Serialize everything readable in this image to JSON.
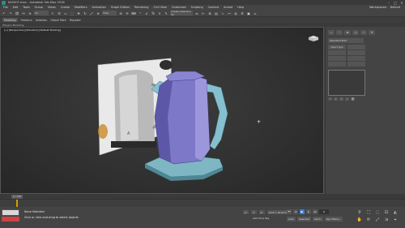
{
  "titlebar": {
    "title": "KA0307.max - Autodesk 3ds Max 2018",
    "minimize": "–",
    "maximize": "□",
    "close": "✕"
  },
  "menubar": {
    "items": [
      "File",
      "Edit",
      "Tools",
      "Group",
      "Views",
      "Create",
      "Modifiers",
      "Animation",
      "Graph Editors",
      "Rendering",
      "Civil View",
      "Customize",
      "Scripting",
      "Content",
      "Arnold",
      "Help"
    ],
    "workspaces": "Workspaces:",
    "workspace_value": "Default"
  },
  "toolbar": {
    "filter_dropdown": "All",
    "view_dropdown": "View",
    "selection_set": "Create Selection Se"
  },
  "ribbon": {
    "modeling_tab": "Modeling",
    "freeform": "Freeform",
    "selection": "Selection",
    "object_paint": "Object Paint",
    "populate": "Populate",
    "sub": "Polygon Modeling"
  },
  "viewport": {
    "label": "[+] [Perspective] [Standard] [Default Shading]"
  },
  "cmdpanel": {
    "tabs": [
      "+",
      "◠",
      "▬",
      "◎",
      "▭",
      "⚒"
    ],
    "dropdown": "Standard Prim",
    "buttons": [
      "Object Type",
      "",
      "",
      "",
      "",
      "",
      "",
      ""
    ],
    "list_icons": [
      "⊣",
      "⟂",
      "⎔",
      "∕",
      "🗑"
    ]
  },
  "timeline": {
    "frame_label": "0 / 100"
  },
  "status": {
    "line1": "None Selected",
    "line2": "Click or click-and-drag to select objects",
    "x": "X:",
    "y": "Y:",
    "z": "Z:",
    "grid": "Grid = 10.0cm",
    "add_time_tag": "Add Time Tag",
    "frame": "0",
    "auto": "Auto",
    "selected": "Selected",
    "set_key": "Set K.",
    "key_filters": "Key Filters..."
  },
  "colors": {
    "kettle_body": "#7e78c8",
    "kettle_base": "#7fb6c4",
    "kettle_handle": "#86bfd0",
    "play_button": "#3a7bd5"
  }
}
